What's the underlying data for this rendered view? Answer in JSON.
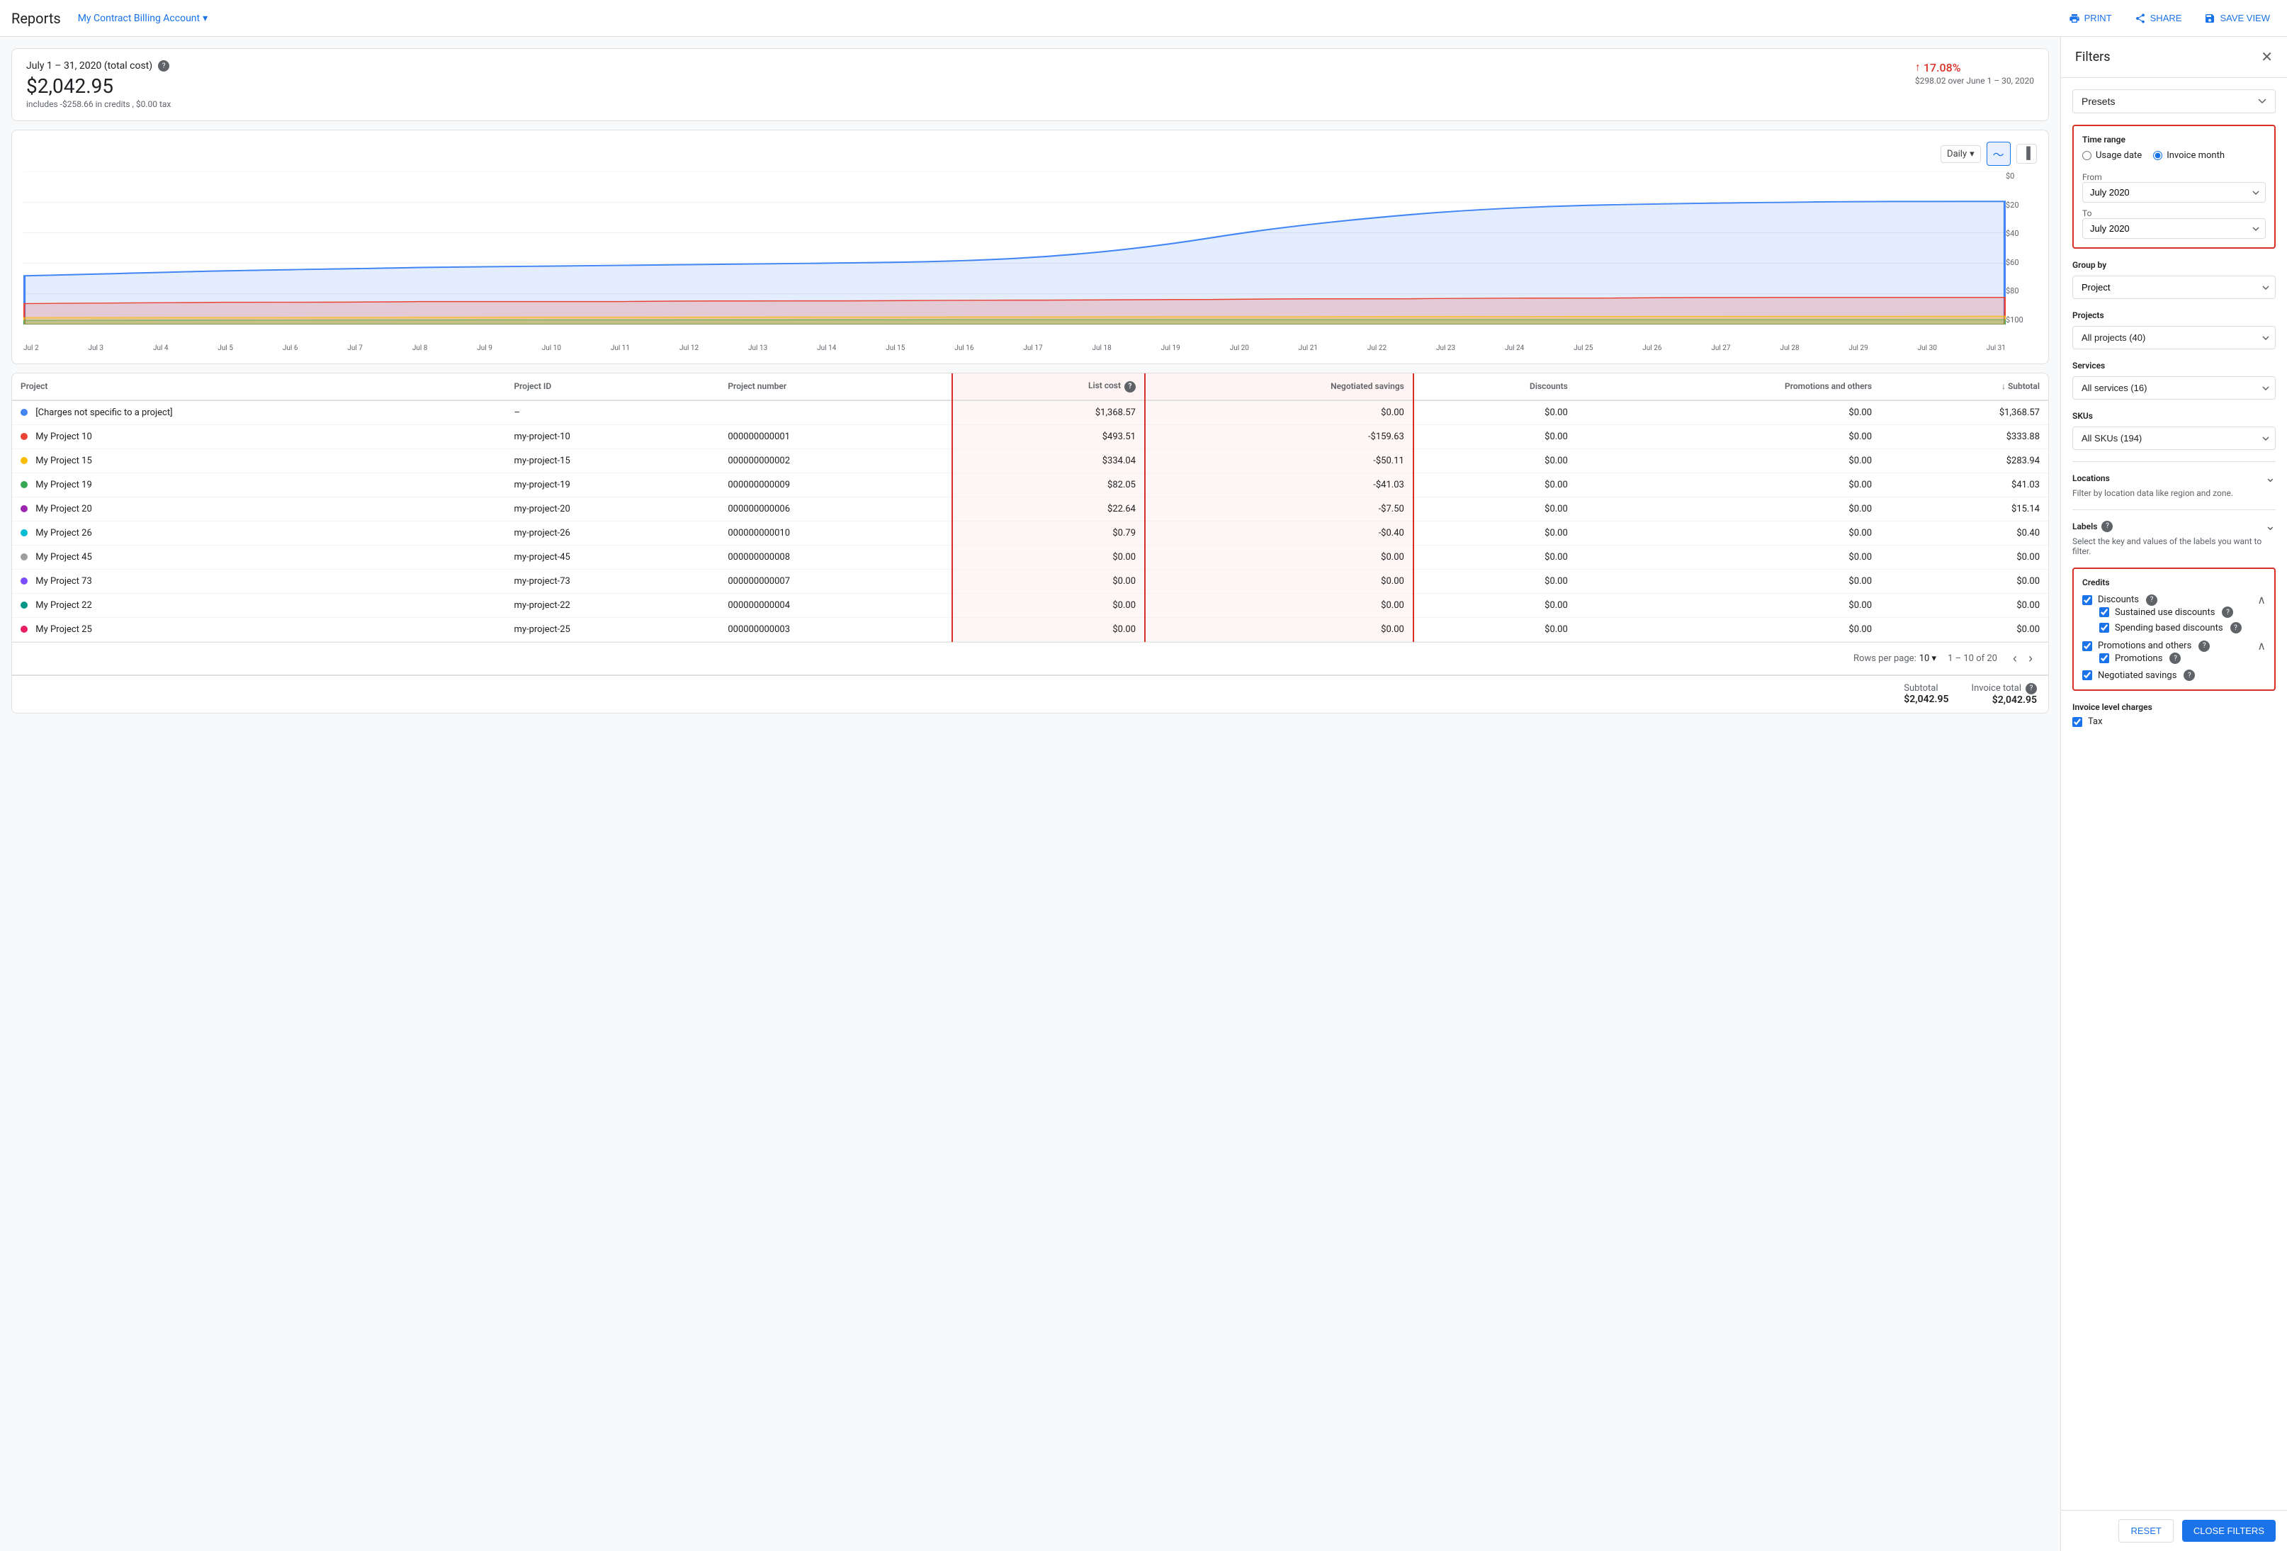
{
  "topbar": {
    "title": "Reports",
    "account": "My Contract Billing Account",
    "actions": {
      "print": "PRINT",
      "share": "SHARE",
      "save_view": "SAVE VIEW"
    }
  },
  "summary": {
    "date_range": "July 1 – 31, 2020 (total cost)",
    "cost": "$2,042.95",
    "sub": "includes -$258.66 in credits , $0.00 tax",
    "change_pct": "17.08%",
    "change_amount": "$298.02 over June 1 – 30, 2020"
  },
  "chart": {
    "view_options": [
      "Daily"
    ],
    "y_labels": [
      "$100",
      "$80",
      "$60",
      "$40",
      "$20",
      "$0"
    ],
    "x_labels": [
      "Jul 2",
      "Jul 3",
      "Jul 4",
      "Jul 5",
      "Jul 6",
      "Jul 7",
      "Jul 8",
      "Jul 9",
      "Jul 10",
      "Jul 11",
      "Jul 12",
      "Jul 13",
      "Jul 14",
      "Jul 15",
      "Jul 16",
      "Jul 17",
      "Jul 18",
      "Jul 19",
      "Jul 20",
      "Jul 21",
      "Jul 22",
      "Jul 23",
      "Jul 24",
      "Jul 25",
      "Jul 26",
      "Jul 27",
      "Jul 28",
      "Jul 29",
      "Jul 30",
      "Jul 31"
    ]
  },
  "table": {
    "columns": [
      "Project",
      "Project ID",
      "Project number",
      "List cost",
      "Negotiated savings",
      "Discounts",
      "Promotions and others",
      "Subtotal"
    ],
    "rows": [
      {
        "name": "[Charges not specific to a project]",
        "id": "–",
        "number": "",
        "list_cost": "$1,368.57",
        "neg_savings": "$0.00",
        "discounts": "$0.00",
        "promotions": "$0.00",
        "subtotal": "$1,368.57",
        "color": "#4285f4"
      },
      {
        "name": "My Project 10",
        "id": "my-project-10",
        "number": "000000000001",
        "list_cost": "$493.51",
        "neg_savings": "-$159.63",
        "discounts": "$0.00",
        "promotions": "$0.00",
        "subtotal": "$333.88",
        "color": "#ea4335"
      },
      {
        "name": "My Project 15",
        "id": "my-project-15",
        "number": "000000000002",
        "list_cost": "$334.04",
        "neg_savings": "-$50.11",
        "discounts": "$0.00",
        "promotions": "$0.00",
        "subtotal": "$283.94",
        "color": "#fbbc04"
      },
      {
        "name": "My Project 19",
        "id": "my-project-19",
        "number": "000000000009",
        "list_cost": "$82.05",
        "neg_savings": "-$41.03",
        "discounts": "$0.00",
        "promotions": "$0.00",
        "subtotal": "$41.03",
        "color": "#34a853"
      },
      {
        "name": "My Project 20",
        "id": "my-project-20",
        "number": "000000000006",
        "list_cost": "$22.64",
        "neg_savings": "-$7.50",
        "discounts": "$0.00",
        "promotions": "$0.00",
        "subtotal": "$15.14",
        "color": "#9c27b0"
      },
      {
        "name": "My Project 26",
        "id": "my-project-26",
        "number": "000000000010",
        "list_cost": "$0.79",
        "neg_savings": "-$0.40",
        "discounts": "$0.00",
        "promotions": "$0.00",
        "subtotal": "$0.40",
        "color": "#00bcd4"
      },
      {
        "name": "My Project 45",
        "id": "my-project-45",
        "number": "000000000008",
        "list_cost": "$0.00",
        "neg_savings": "$0.00",
        "discounts": "$0.00",
        "promotions": "$0.00",
        "subtotal": "$0.00",
        "color": "#9e9e9e"
      },
      {
        "name": "My Project 73",
        "id": "my-project-73",
        "number": "000000000007",
        "list_cost": "$0.00",
        "neg_savings": "$0.00",
        "discounts": "$0.00",
        "promotions": "$0.00",
        "subtotal": "$0.00",
        "color": "#7c4dff"
      },
      {
        "name": "My Project 22",
        "id": "my-project-22",
        "number": "000000000004",
        "list_cost": "$0.00",
        "neg_savings": "$0.00",
        "discounts": "$0.00",
        "promotions": "$0.00",
        "subtotal": "$0.00",
        "color": "#009688"
      },
      {
        "name": "My Project 25",
        "id": "my-project-25",
        "number": "000000000003",
        "list_cost": "$0.00",
        "neg_savings": "$0.00",
        "discounts": "$0.00",
        "promotions": "$0.00",
        "subtotal": "$0.00",
        "color": "#e91e63"
      }
    ],
    "pagination": {
      "rows_per_page": "10",
      "range": "1 – 10 of 20"
    },
    "totals": {
      "subtotal_label": "Subtotal",
      "subtotal_value": "$2,042.95",
      "invoice_total_label": "Invoice total",
      "invoice_total_value": "$2,042.95"
    }
  },
  "filters": {
    "title": "Filters",
    "presets_label": "Presets",
    "time_range": {
      "title": "Time range",
      "usage_date_label": "Usage date",
      "invoice_month_label": "Invoice month",
      "selected": "invoice_month",
      "from_label": "From",
      "from_value": "July 2020",
      "to_label": "To",
      "to_value": "July 2020"
    },
    "group_by": {
      "title": "Group by",
      "value": "Project"
    },
    "projects": {
      "title": "Projects",
      "value": "All projects (40)"
    },
    "services": {
      "title": "Services",
      "value": "All services (16)"
    },
    "skus": {
      "title": "SKUs",
      "value": "All SKUs (194)"
    },
    "locations": {
      "title": "Locations",
      "sub": "Filter by location data like region and zone."
    },
    "labels": {
      "title": "Labels",
      "sub": "Select the key and values of the labels you want to filter."
    },
    "credits": {
      "title": "Credits",
      "discounts": {
        "label": "Discounts",
        "checked": true,
        "sub_items": [
          {
            "label": "Sustained use discounts",
            "checked": true
          },
          {
            "label": "Spending based discounts",
            "checked": true
          }
        ]
      },
      "promotions_and_others": {
        "label": "Promotions and others",
        "checked": true,
        "sub_items": [
          {
            "label": "Promotions",
            "checked": true
          }
        ]
      },
      "negotiated_savings": {
        "label": "Negotiated savings",
        "checked": true
      }
    },
    "invoice_level_charges": {
      "title": "Invoice level charges",
      "tax": {
        "label": "Tax",
        "checked": true
      }
    },
    "buttons": {
      "reset": "RESET",
      "close_filters": "CLOSE FILTERS"
    }
  }
}
